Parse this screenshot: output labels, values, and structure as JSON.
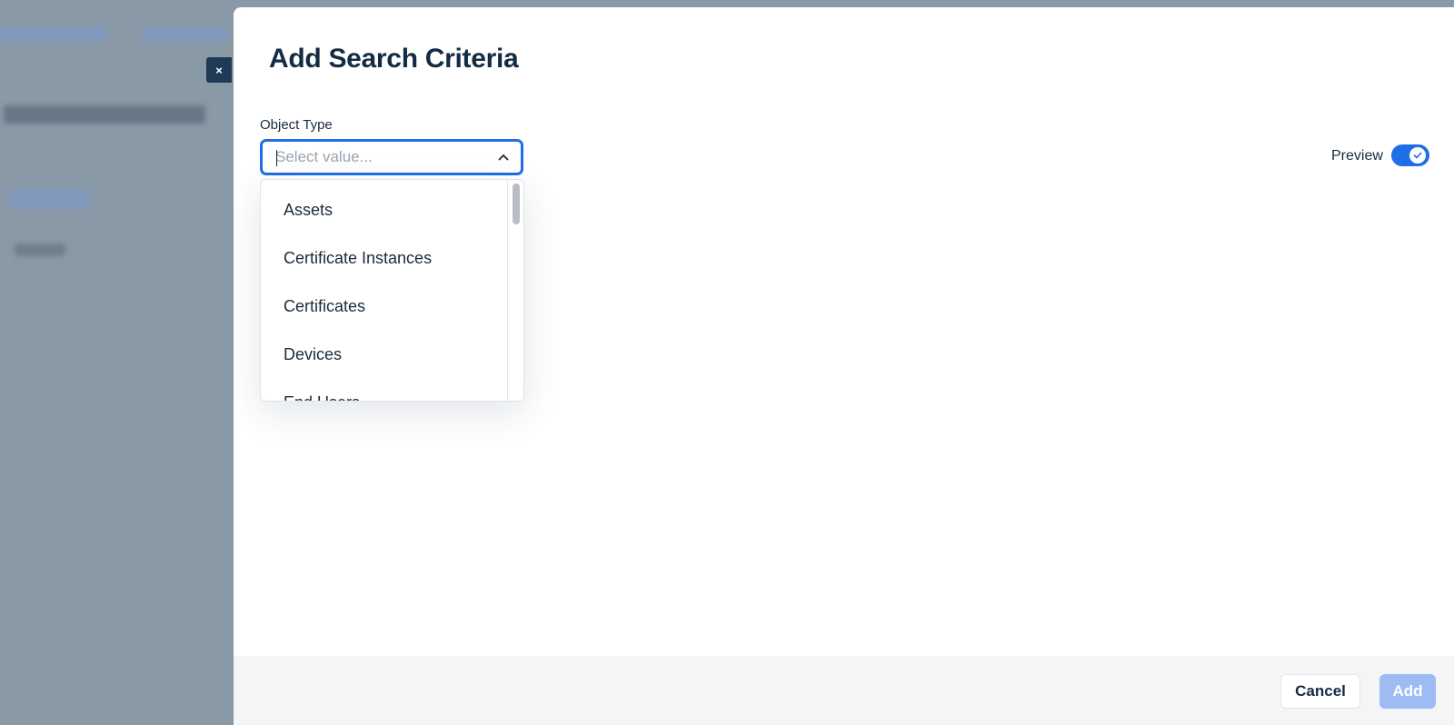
{
  "modal": {
    "title": "Add Search Criteria",
    "close_label": "×"
  },
  "object_type": {
    "label": "Object Type",
    "placeholder": "Select value...",
    "value": "",
    "options": [
      "Assets",
      "Certificate Instances",
      "Certificates",
      "Devices",
      "End Users"
    ]
  },
  "preview": {
    "label": "Preview",
    "enabled": true
  },
  "footer": {
    "cancel_label": "Cancel",
    "add_label": "Add"
  },
  "colors": {
    "accent": "#1e6ee8",
    "add_disabled": "#9dbcf3",
    "title": "#142b44"
  },
  "icons": [
    "close-icon",
    "chevron-up-icon",
    "check-icon"
  ]
}
